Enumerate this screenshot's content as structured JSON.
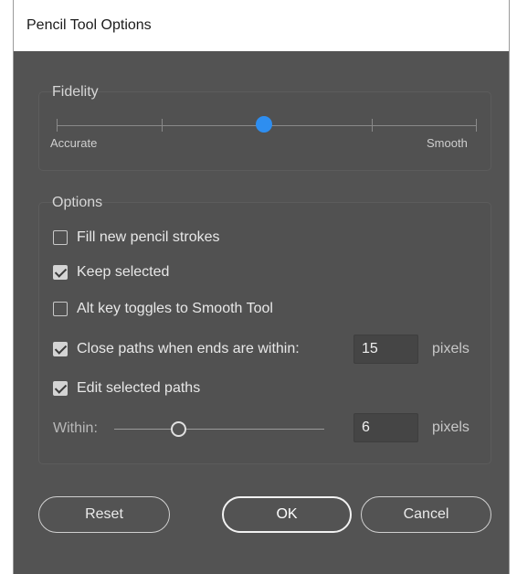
{
  "window": {
    "title": "Pencil Tool Options"
  },
  "fidelity": {
    "title": "Fidelity",
    "left_label": "Accurate",
    "right_label": "Smooth",
    "level": 0.5,
    "accent_color": "#2e8ef0"
  },
  "options": {
    "title": "Options",
    "fill_new": {
      "label": "Fill new pencil strokes",
      "checked": false
    },
    "keep_selected": {
      "label": "Keep selected",
      "checked": true
    },
    "alt_toggle": {
      "label": "Alt key toggles to Smooth Tool",
      "checked": false
    },
    "close_paths": {
      "label": "Close paths when ends are within:",
      "checked": true,
      "value": "15",
      "unit": "pixels"
    },
    "edit_selected": {
      "label": "Edit selected paths",
      "checked": true
    },
    "within": {
      "label": "Within:",
      "value": "6",
      "unit": "pixels",
      "level": 0.25
    }
  },
  "buttons": {
    "reset": "Reset",
    "ok": "OK",
    "cancel": "Cancel"
  }
}
